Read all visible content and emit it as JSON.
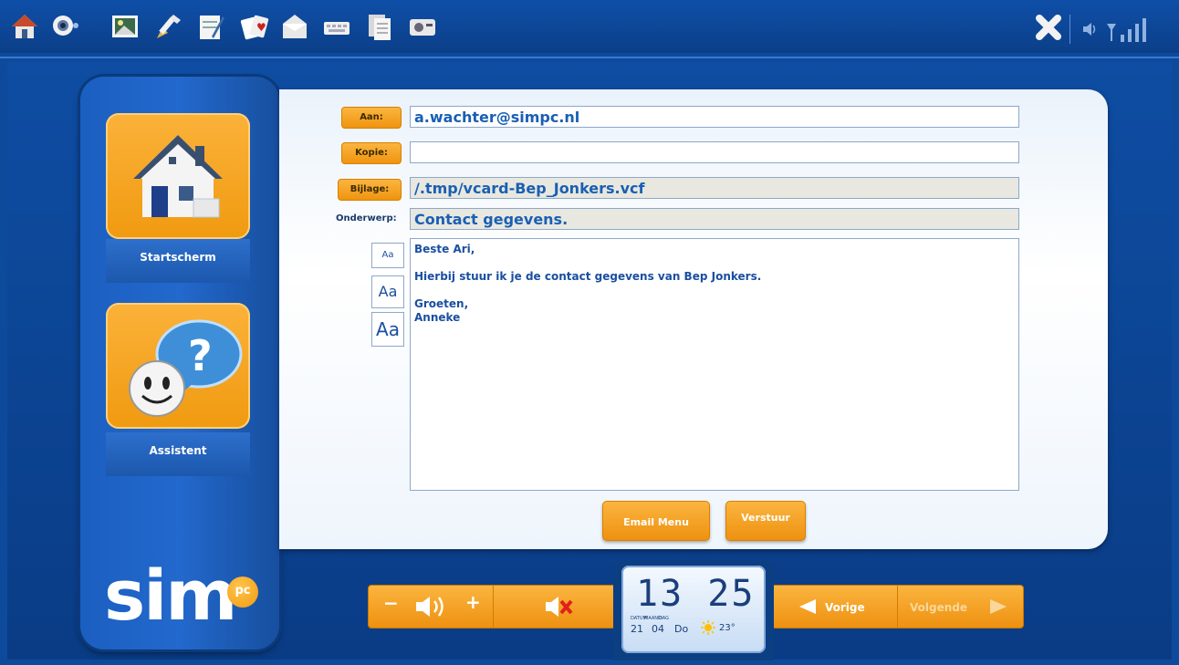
{
  "toolbar": {
    "icons": [
      "home-icon",
      "webcam-icon",
      "photo-icon",
      "paint-icon",
      "editor-icon",
      "cards-icon",
      "mail-icon",
      "keyboard-icon",
      "documents-icon",
      "radio-icon"
    ],
    "close_icon": "close-icon",
    "status_icons": [
      "volume-icon",
      "signal-icon"
    ]
  },
  "sidebar": {
    "home_label": "Startscherm",
    "assistant_label": "Assistent",
    "logo": "sim",
    "logo_badge": "pc"
  },
  "email": {
    "to_label": "Aan:",
    "to_value": "a.wachter@simpc.nl",
    "cc_label": "Kopie:",
    "cc_value": "",
    "attachment_label": "Bijlage:",
    "attachment_value": "/.tmp/vcard-Bep_Jonkers.vcf",
    "subject_label": "Onderwerp:",
    "subject_value": "Contact gegevens.",
    "body_lines": [
      "Beste Ari,",
      "Hierbij stuur ik je de contact gegevens van Bep Jonkers.",
      "Groeten,",
      "Anneke"
    ],
    "font_buttons": [
      "Aa",
      "Aa",
      "Aa"
    ],
    "email_menu_label": "Email Menu",
    "send_label": "Verstuur"
  },
  "controls": {
    "vol_minus": "−",
    "vol_plus": "+",
    "prev_label": "Vorige",
    "next_label": "Volgende"
  },
  "clock": {
    "time": "13 25",
    "date_labels": [
      "DATUM",
      "MAAND",
      "DAG"
    ],
    "day": "21",
    "month": "04",
    "weekday": "Do",
    "temperature": "23°"
  },
  "colors": {
    "background": "#0d4a9c",
    "accent_orange": "#f5a623",
    "text_blue": "#1a5fb4"
  }
}
